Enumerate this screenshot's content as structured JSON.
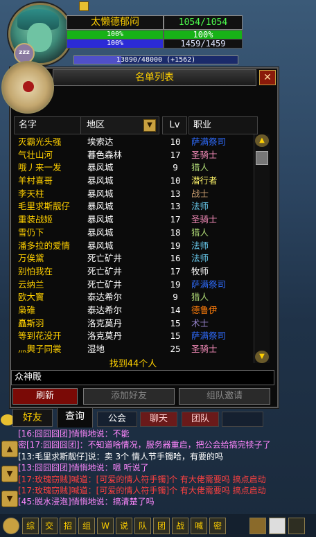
{
  "unit": {
    "name": "太懒德郁闷",
    "hp_text": "1054/1054",
    "hp_bar_pct": "100%",
    "hp_pct_right": "100%",
    "mp_bar_pct": "100%",
    "mp_text": "1459/1459",
    "xp_text": "13890/48000 (+1562)",
    "xp_fraction": 0.29,
    "sleep_badge": "zzz"
  },
  "who_panel": {
    "title": "名单列表",
    "close_glyph": "✕",
    "columns": {
      "name": "名字",
      "zone": "地区",
      "level": "Lv",
      "class": "职业"
    },
    "zone_dropdown_glyph": "▼",
    "rows": [
      {
        "name": "灭霸光头强",
        "zone": "埃索达",
        "level": "10",
        "class": "萨满祭司",
        "class_color": "#2f6cff"
      },
      {
        "name": "气壮山河",
        "zone": "暮色森林",
        "level": "17",
        "class": "圣骑士",
        "class_color": "#f58cba"
      },
      {
        "name": "哦丿来一发",
        "zone": "暴风城",
        "level": "9",
        "class": "猎人",
        "class_color": "#abd473"
      },
      {
        "name": "羊村喜哥",
        "zone": "暴风城",
        "level": "10",
        "class": "潜行者",
        "class_color": "#fff569"
      },
      {
        "name": "李天柱",
        "zone": "暴风城",
        "level": "13",
        "class": "战士",
        "class_color": "#c79c6e"
      },
      {
        "name": "毛里求斯靓仔",
        "zone": "暴风城",
        "level": "13",
        "class": "法师",
        "class_color": "#69ccf0"
      },
      {
        "name": "重装战姬",
        "zone": "暴风城",
        "level": "17",
        "class": "圣骑士",
        "class_color": "#f58cba"
      },
      {
        "name": "雪仍下",
        "zone": "暴风城",
        "level": "18",
        "class": "猎人",
        "class_color": "#abd473"
      },
      {
        "name": "潘多拉的爱情",
        "zone": "暴风城",
        "level": "19",
        "class": "法师",
        "class_color": "#69ccf0"
      },
      {
        "name": "万俟黛",
        "zone": "死亡矿井",
        "level": "16",
        "class": "法师",
        "class_color": "#69ccf0"
      },
      {
        "name": "别怕我在",
        "zone": "死亡矿井",
        "level": "17",
        "class": "牧师",
        "class_color": "#ffffff"
      },
      {
        "name": "云纳兰",
        "zone": "死亡矿井",
        "level": "19",
        "class": "萨满祭司",
        "class_color": "#2f6cff"
      },
      {
        "name": "欧大竇",
        "zone": "泰达希尔",
        "level": "9",
        "class": "猎人",
        "class_color": "#abd473"
      },
      {
        "name": "枭碓",
        "zone": "泰达希尔",
        "level": "14",
        "class": "德鲁伊",
        "class_color": "#ff7d0a"
      },
      {
        "name": "矗斯羽",
        "zone": "洛克莫丹",
        "level": "15",
        "class": "术士",
        "class_color": "#9482c9"
      },
      {
        "name": "等到花没开",
        "zone": "洛克莫丹",
        "level": "15",
        "class": "萨满祭司",
        "class_color": "#2f6cff"
      },
      {
        "name": "灬輿子同裳",
        "zone": "湿地",
        "level": "25",
        "class": "圣骑士",
        "class_color": "#f58cba"
      }
    ],
    "found_text": "找到44个人",
    "search_value": "众神殿",
    "buttons": {
      "refresh": "刷新",
      "add_friend": "添加好友",
      "group_invite": "组队邀请"
    },
    "scroll_up": "▲",
    "scroll_down": "▼"
  },
  "tabs": {
    "friends": "好友",
    "who": "查询",
    "guild": "公会",
    "chat": "聊天",
    "team": "团队"
  },
  "chat_side_buttons": {
    "up": "▲",
    "down": "▼",
    "bottom": "▼"
  },
  "chat": [
    {
      "text": "[16:囧囧囧团]悄悄地说：不能",
      "color": "#ff88ff"
    },
    {
      "text": "密[17:囧囧囧团]：不知道啥情况，服务器重启，把公会给搞完犊子了",
      "color": "#ff88ff"
    },
    {
      "text": "[13:毛里求斯靓仔]说：卖 3个 情人节手镯哈，有要的吗",
      "color": "#ffffff"
    },
    {
      "text": "[13:囧囧囧团]悄悄地说：嗯 听说了",
      "color": "#ff88ff"
    },
    {
      "text": "[17:玫瑰窃贼]喊道：[可爱的情人符手镯]个 有大佬需要吗 搞点启动",
      "color": "#ff4040"
    },
    {
      "text": "[17:玫瑰窃贼]喊道：[可爱的情人符手镯]个 有大佬需要吗 搞点启动",
      "color": "#ff4040"
    },
    {
      "text": "[45:脱水浸泡]悄悄地说：搞清楚了吗",
      "color": "#ff88ff"
    }
  ],
  "bottom_bar": [
    "综",
    "交",
    "招",
    "组",
    "W",
    "说",
    "队",
    "团",
    "战",
    "喊",
    "密"
  ]
}
